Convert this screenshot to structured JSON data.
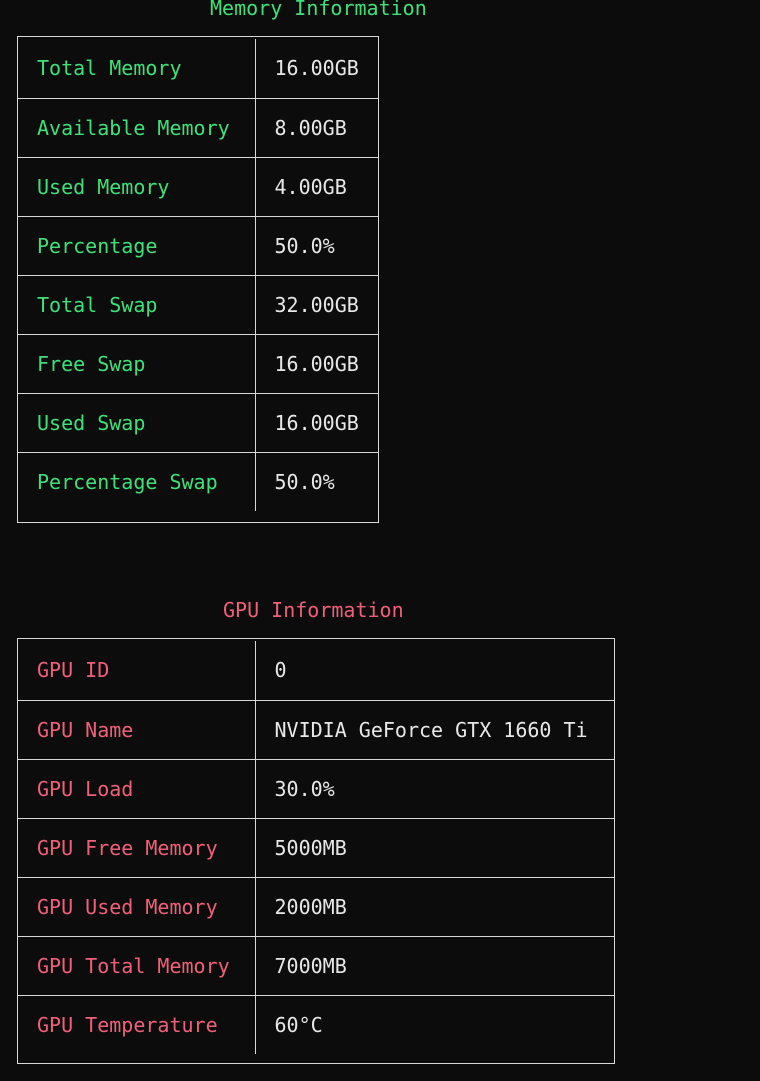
{
  "memory": {
    "title": "Memory Information",
    "rows": [
      {
        "label": "Total Memory",
        "value": "16.00GB"
      },
      {
        "label": "Available Memory",
        "value": "8.00GB"
      },
      {
        "label": "Used Memory",
        "value": "4.00GB"
      },
      {
        "label": "Percentage",
        "value": "50.0%"
      },
      {
        "label": "Total Swap",
        "value": "32.00GB"
      },
      {
        "label": "Free Swap",
        "value": "16.00GB"
      },
      {
        "label": "Used Swap",
        "value": "16.00GB"
      },
      {
        "label": "Percentage Swap",
        "value": "50.0%"
      }
    ]
  },
  "gpu": {
    "title": "GPU Information",
    "rows": [
      {
        "label": "GPU ID",
        "value": "0"
      },
      {
        "label": "GPU Name",
        "value": "NVIDIA GeForce GTX 1660 Ti"
      },
      {
        "label": "GPU Load",
        "value": "30.0%"
      },
      {
        "label": "GPU Free Memory",
        "value": "5000MB"
      },
      {
        "label": "GPU Used Memory",
        "value": "2000MB"
      },
      {
        "label": "GPU Total Memory",
        "value": "7000MB"
      },
      {
        "label": "GPU Temperature",
        "value": "60°C"
      }
    ]
  },
  "colors": {
    "background": "#0c0c0c",
    "memory_accent": "#3fe07a",
    "gpu_accent": "#f0607a",
    "value_text": "#e8e8e8",
    "border": "#d8d8d8"
  }
}
